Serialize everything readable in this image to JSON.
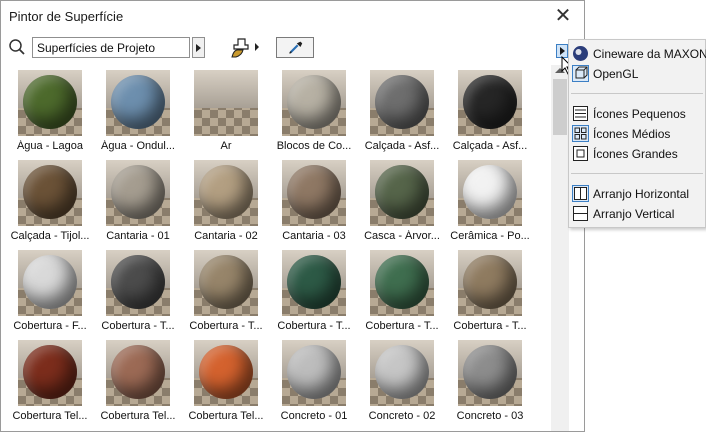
{
  "window": {
    "title": "Pintor de Superfície"
  },
  "toolbar": {
    "combo_value": "Superfícies de Projeto"
  },
  "materials": [
    {
      "label": "Água - Lagoa",
      "color": "#4d6a2c"
    },
    {
      "label": "Água - Ondul...",
      "color": "#6d8fae"
    },
    {
      "label": "Ar",
      "color": "none"
    },
    {
      "label": "Blocos de Co...",
      "color": "#b7b1a4"
    },
    {
      "label": "Calçada - Asf...",
      "color": "#6e6e6e"
    },
    {
      "label": "Calçada - Asf...",
      "color": "#262626"
    },
    {
      "label": "Calçada - Tijol...",
      "color": "#6b5237"
    },
    {
      "label": "Cantaria - 01",
      "color": "#a59d90"
    },
    {
      "label": "Cantaria - 02",
      "color": "#b39f82"
    },
    {
      "label": "Cantaria - 03",
      "color": "#8f7864"
    },
    {
      "label": "Casca - Árvor...",
      "color": "#56654a"
    },
    {
      "label": "Cerâmica - Po...",
      "color": "#f2f2f2"
    },
    {
      "label": "Cobertura - F...",
      "color": "#d9d9d9"
    },
    {
      "label": "Cobertura - T...",
      "color": "#4c4c4c"
    },
    {
      "label": "Cobertura - T...",
      "color": "#97856a"
    },
    {
      "label": "Cobertura - T...",
      "color": "#2d5a46"
    },
    {
      "label": "Cobertura - T...",
      "color": "#3f6e4f"
    },
    {
      "label": "Cobertura - T...",
      "color": "#8f7b60"
    },
    {
      "label": "Cobertura Tel...",
      "color": "#7c2d1c"
    },
    {
      "label": "Cobertura Tel...",
      "color": "#9c6a55"
    },
    {
      "label": "Cobertura Tel...",
      "color": "#d4622e"
    },
    {
      "label": "Concreto - 01",
      "color": "#bdbdbd"
    },
    {
      "label": "Concreto - 02",
      "color": "#c6c6c6"
    },
    {
      "label": "Concreto - 03",
      "color": "#8d8d8d"
    }
  ],
  "menu": {
    "items": [
      {
        "label": "Cineware da MAXON",
        "icon": "cineware-icon"
      },
      {
        "label": "OpenGL",
        "icon": "opengl-icon"
      },
      {
        "label": "Ícones Pequenos",
        "icon": "list-icon"
      },
      {
        "label": "Ícones Médios",
        "icon": "grid-icon"
      },
      {
        "label": "Ícones Grandes",
        "icon": "large-icon"
      },
      {
        "label": "Arranjo Horizontal",
        "icon": "split-vertical-icon"
      },
      {
        "label": "Arranjo Vertical",
        "icon": "split-horizontal-icon"
      }
    ]
  }
}
